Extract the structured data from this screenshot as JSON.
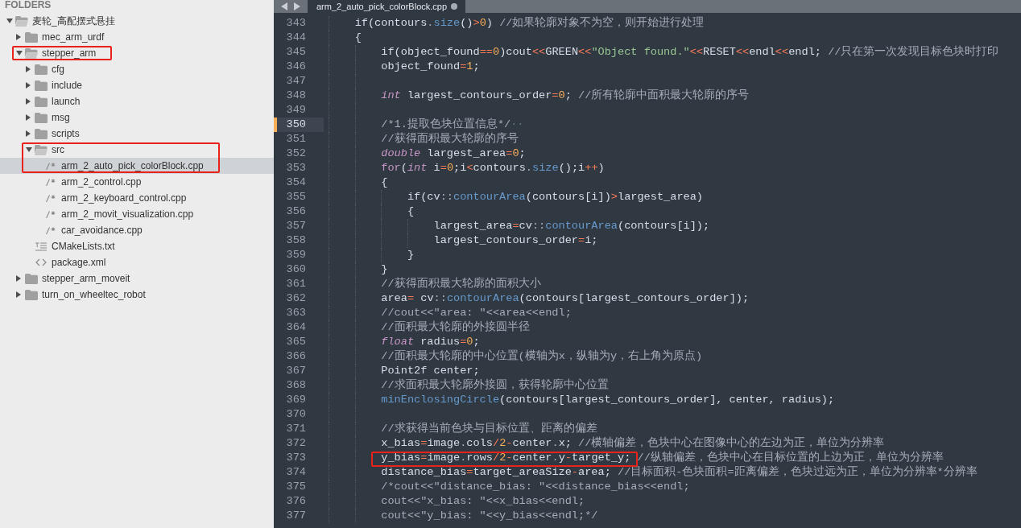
{
  "sidebar": {
    "header": "FOLDERS",
    "tree": [
      {
        "kind": "folder",
        "label": "麦轮_高配摆式悬挂",
        "expanded": true,
        "selected": false,
        "annotated": false,
        "children": [
          {
            "kind": "folder",
            "label": "mec_arm_urdf",
            "expanded": false,
            "selected": false,
            "annotated": false
          },
          {
            "kind": "folder",
            "label": "stepper_arm",
            "expanded": true,
            "selected": false,
            "annotated": true,
            "children": [
              {
                "kind": "folder",
                "label": "cfg",
                "expanded": false,
                "selected": false,
                "annotated": false
              },
              {
                "kind": "folder",
                "label": "include",
                "expanded": false,
                "selected": false,
                "annotated": false
              },
              {
                "kind": "folder",
                "label": "launch",
                "expanded": false,
                "selected": false,
                "annotated": false
              },
              {
                "kind": "folder",
                "label": "msg",
                "expanded": false,
                "selected": false,
                "annotated": false
              },
              {
                "kind": "folder",
                "label": "scripts",
                "expanded": false,
                "selected": false,
                "annotated": false
              },
              {
                "kind": "folder",
                "label": "src",
                "expanded": true,
                "selected": false,
                "annotated": true,
                "children": [
                  {
                    "kind": "source",
                    "label": "arm_2_auto_pick_colorBlock.cpp",
                    "selected": true,
                    "annotated": true
                  },
                  {
                    "kind": "source",
                    "label": "arm_2_control.cpp",
                    "selected": false,
                    "annotated": false
                  },
                  {
                    "kind": "source",
                    "label": "arm_2_keyboard_control.cpp",
                    "selected": false,
                    "annotated": false
                  },
                  {
                    "kind": "source",
                    "label": "arm_2_movit_visualization.cpp",
                    "selected": false,
                    "annotated": false
                  },
                  {
                    "kind": "source",
                    "label": "car_avoidance.cpp",
                    "selected": false,
                    "annotated": false
                  }
                ]
              },
              {
                "kind": "text",
                "label": "CMakeLists.txt",
                "selected": false,
                "annotated": false
              },
              {
                "kind": "markup",
                "label": "package.xml",
                "selected": false,
                "annotated": false
              }
            ]
          },
          {
            "kind": "folder",
            "label": "stepper_arm_moveit",
            "expanded": false,
            "selected": false,
            "annotated": false
          },
          {
            "kind": "folder",
            "label": "turn_on_wheeltec_robot",
            "expanded": false,
            "selected": false,
            "annotated": false
          }
        ]
      }
    ]
  },
  "editor": {
    "tabs": [
      {
        "title": "arm_2_auto_pick_colorBlock.cpp",
        "selected": true,
        "modified": true
      }
    ],
    "lines": [
      {
        "number": "343",
        "current": false,
        "annotated": false,
        "tokens": [
          {
            "kind": "plain",
            "text": "    if(contours"
          },
          {
            "kind": "punct",
            "text": "."
          },
          {
            "kind": "function",
            "text": "size"
          },
          {
            "kind": "plain",
            "text": "()"
          },
          {
            "kind": "operator",
            "text": ">"
          },
          {
            "kind": "number",
            "text": "0"
          },
          {
            "kind": "plain",
            "text": ") "
          },
          {
            "kind": "comment",
            "text": "//如果轮廓对象不为空，则开始进行处理"
          }
        ]
      },
      {
        "number": "344",
        "current": false,
        "annotated": false,
        "tokens": [
          {
            "kind": "plain",
            "text": "    {"
          }
        ]
      },
      {
        "number": "345",
        "current": false,
        "annotated": false,
        "tokens": [
          {
            "kind": "plain",
            "text": "        if(object_found"
          },
          {
            "kind": "operator",
            "text": "=="
          },
          {
            "kind": "number",
            "text": "0"
          },
          {
            "kind": "plain",
            "text": ")cout"
          },
          {
            "kind": "operator",
            "text": "<<"
          },
          {
            "kind": "plain",
            "text": "GREEN"
          },
          {
            "kind": "operator",
            "text": "<<"
          },
          {
            "kind": "string",
            "text": "\"Object found.\""
          },
          {
            "kind": "operator",
            "text": "<<"
          },
          {
            "kind": "plain",
            "text": "RESET"
          },
          {
            "kind": "operator",
            "text": "<<"
          },
          {
            "kind": "plain",
            "text": "endl"
          },
          {
            "kind": "operator",
            "text": "<<"
          },
          {
            "kind": "plain",
            "text": "endl; "
          },
          {
            "kind": "comment",
            "text": "//只在第一次发现目标色块时打印"
          }
        ]
      },
      {
        "number": "346",
        "current": false,
        "annotated": false,
        "tokens": [
          {
            "kind": "plain",
            "text": "        object_found"
          },
          {
            "kind": "operator",
            "text": "="
          },
          {
            "kind": "number",
            "text": "1"
          },
          {
            "kind": "plain",
            "text": ";"
          }
        ]
      },
      {
        "number": "347",
        "current": false,
        "annotated": false
      },
      {
        "number": "348",
        "current": false,
        "annotated": false,
        "tokens": [
          {
            "kind": "type",
            "text": "        int"
          },
          {
            "kind": "plain",
            "text": " largest_contours_order"
          },
          {
            "kind": "operator",
            "text": "="
          },
          {
            "kind": "number",
            "text": "0"
          },
          {
            "kind": "plain",
            "text": "; "
          },
          {
            "kind": "comment",
            "text": "//所有轮廓中面积最大轮廓的序号"
          }
        ]
      },
      {
        "number": "349",
        "current": false,
        "annotated": false
      },
      {
        "number": "350",
        "current": true,
        "annotated": false,
        "tokens": [
          {
            "kind": "comment",
            "text": "        /*1.提取色块位置信息*/"
          },
          {
            "kind": "whitespace",
            "text": "··"
          }
        ]
      },
      {
        "number": "351",
        "current": false,
        "annotated": false,
        "tokens": [
          {
            "kind": "comment",
            "text": "        //获得面积最大轮廓的序号"
          }
        ]
      },
      {
        "number": "352",
        "current": false,
        "annotated": false,
        "tokens": [
          {
            "kind": "type",
            "text": "        double"
          },
          {
            "kind": "plain",
            "text": " largest_area"
          },
          {
            "kind": "operator",
            "text": "="
          },
          {
            "kind": "number",
            "text": "0"
          },
          {
            "kind": "plain",
            "text": ";"
          }
        ]
      },
      {
        "number": "353",
        "current": false,
        "annotated": false,
        "tokens": [
          {
            "kind": "keyword",
            "text": "        for"
          },
          {
            "kind": "plain",
            "text": "("
          },
          {
            "kind": "type",
            "text": "int"
          },
          {
            "kind": "plain",
            "text": " i"
          },
          {
            "kind": "operator",
            "text": "="
          },
          {
            "kind": "number",
            "text": "0"
          },
          {
            "kind": "plain",
            "text": ";i"
          },
          {
            "kind": "operator",
            "text": "<"
          },
          {
            "kind": "plain",
            "text": "contours"
          },
          {
            "kind": "punct",
            "text": "."
          },
          {
            "kind": "function",
            "text": "size"
          },
          {
            "kind": "plain",
            "text": "();i"
          },
          {
            "kind": "operator",
            "text": "++"
          },
          {
            "kind": "plain",
            "text": ")"
          }
        ]
      },
      {
        "number": "354",
        "current": false,
        "annotated": false,
        "tokens": [
          {
            "kind": "plain",
            "text": "        {"
          }
        ]
      },
      {
        "number": "355",
        "current": false,
        "annotated": false,
        "tokens": [
          {
            "kind": "plain",
            "text": "            if(cv"
          },
          {
            "kind": "punct",
            "text": "::"
          },
          {
            "kind": "function",
            "text": "contourArea"
          },
          {
            "kind": "plain",
            "text": "(contours[i])"
          },
          {
            "kind": "operator",
            "text": ">"
          },
          {
            "kind": "plain",
            "text": "largest_area)"
          }
        ]
      },
      {
        "number": "356",
        "current": false,
        "annotated": false,
        "tokens": [
          {
            "kind": "plain",
            "text": "            {"
          }
        ]
      },
      {
        "number": "357",
        "current": false,
        "annotated": false,
        "tokens": [
          {
            "kind": "plain",
            "text": "                largest_area"
          },
          {
            "kind": "operator",
            "text": "="
          },
          {
            "kind": "plain",
            "text": "cv"
          },
          {
            "kind": "punct",
            "text": "::"
          },
          {
            "kind": "function",
            "text": "contourArea"
          },
          {
            "kind": "plain",
            "text": "(contours[i]);"
          }
        ]
      },
      {
        "number": "358",
        "current": false,
        "annotated": false,
        "tokens": [
          {
            "kind": "plain",
            "text": "                largest_contours_order"
          },
          {
            "kind": "operator",
            "text": "="
          },
          {
            "kind": "plain",
            "text": "i;"
          }
        ]
      },
      {
        "number": "359",
        "current": false,
        "annotated": false,
        "tokens": [
          {
            "kind": "plain",
            "text": "            }"
          }
        ]
      },
      {
        "number": "360",
        "current": false,
        "annotated": false,
        "tokens": [
          {
            "kind": "plain",
            "text": "        }"
          }
        ]
      },
      {
        "number": "361",
        "current": false,
        "annotated": false,
        "tokens": [
          {
            "kind": "comment",
            "text": "        //获得面积最大轮廓的面积大小"
          }
        ]
      },
      {
        "number": "362",
        "current": false,
        "annotated": false,
        "tokens": [
          {
            "kind": "plain",
            "text": "        area"
          },
          {
            "kind": "operator",
            "text": "="
          },
          {
            "kind": "plain",
            "text": " cv"
          },
          {
            "kind": "punct",
            "text": "::"
          },
          {
            "kind": "function",
            "text": "contourArea"
          },
          {
            "kind": "plain",
            "text": "(contours[largest_contours_order]);"
          }
        ]
      },
      {
        "number": "363",
        "current": false,
        "annotated": false,
        "tokens": [
          {
            "kind": "comment",
            "text": "        //cout<<\"area: \"<<area<<endl;"
          }
        ]
      },
      {
        "number": "364",
        "current": false,
        "annotated": false,
        "tokens": [
          {
            "kind": "comment",
            "text": "        //面积最大轮廓的外接圆半径"
          }
        ]
      },
      {
        "number": "365",
        "current": false,
        "annotated": false,
        "tokens": [
          {
            "kind": "type",
            "text": "        float"
          },
          {
            "kind": "plain",
            "text": " radius"
          },
          {
            "kind": "operator",
            "text": "="
          },
          {
            "kind": "number",
            "text": "0"
          },
          {
            "kind": "plain",
            "text": ";"
          }
        ]
      },
      {
        "number": "366",
        "current": false,
        "annotated": false,
        "tokens": [
          {
            "kind": "comment",
            "text": "        //面积最大轮廓的中心位置(横轴为x，纵轴为y，右上角为原点)"
          }
        ]
      },
      {
        "number": "367",
        "current": false,
        "annotated": false,
        "tokens": [
          {
            "kind": "plain",
            "text": "        Point2f center;"
          }
        ]
      },
      {
        "number": "368",
        "current": false,
        "annotated": false,
        "tokens": [
          {
            "kind": "comment",
            "text": "        //求面积最大轮廓外接圆，获得轮廓中心位置"
          }
        ]
      },
      {
        "number": "369",
        "current": false,
        "annotated": false,
        "tokens": [
          {
            "kind": "function",
            "text": "        minEnclosingCircle"
          },
          {
            "kind": "plain",
            "text": "(contours[largest_contours_order], center, radius);"
          }
        ]
      },
      {
        "number": "370",
        "current": false,
        "annotated": false
      },
      {
        "number": "371",
        "current": false,
        "annotated": false,
        "tokens": [
          {
            "kind": "comment",
            "text": "        //求获得当前色块与目标位置、距离的偏差"
          }
        ]
      },
      {
        "number": "372",
        "current": false,
        "annotated": false,
        "tokens": [
          {
            "kind": "plain",
            "text": "        x_bias"
          },
          {
            "kind": "operator",
            "text": "="
          },
          {
            "kind": "plain",
            "text": "image"
          },
          {
            "kind": "punct",
            "text": "."
          },
          {
            "kind": "plain",
            "text": "cols"
          },
          {
            "kind": "operator",
            "text": "/"
          },
          {
            "kind": "number",
            "text": "2"
          },
          {
            "kind": "operator",
            "text": "-"
          },
          {
            "kind": "plain",
            "text": "center"
          },
          {
            "kind": "punct",
            "text": "."
          },
          {
            "kind": "plain",
            "text": "x; "
          },
          {
            "kind": "comment",
            "text": "//横轴偏差，色块中心在图像中心的左边为正，单位为分辨率"
          }
        ]
      },
      {
        "number": "373",
        "current": false,
        "annotated": true,
        "tokens": [
          {
            "kind": "plain",
            "text": "        y_bias"
          },
          {
            "kind": "operator",
            "text": "="
          },
          {
            "kind": "plain",
            "text": "image"
          },
          {
            "kind": "punct",
            "text": "."
          },
          {
            "kind": "plain",
            "text": "rows"
          },
          {
            "kind": "operator",
            "text": "/"
          },
          {
            "kind": "number",
            "text": "2"
          },
          {
            "kind": "operator",
            "text": "-"
          },
          {
            "kind": "plain",
            "text": "center"
          },
          {
            "kind": "punct",
            "text": "."
          },
          {
            "kind": "plain",
            "text": "y"
          },
          {
            "kind": "operator",
            "text": "-"
          },
          {
            "kind": "plain",
            "text": "target_y; "
          },
          {
            "kind": "comment",
            "text": "//纵轴偏差，色块中心在目标位置的上边为正，单位为分辨率"
          }
        ]
      },
      {
        "number": "374",
        "current": false,
        "annotated": false,
        "tokens": [
          {
            "kind": "plain",
            "text": "        distance_bias"
          },
          {
            "kind": "operator",
            "text": "="
          },
          {
            "kind": "plain",
            "text": "target_areaSize"
          },
          {
            "kind": "operator",
            "text": "-"
          },
          {
            "kind": "plain",
            "text": "area; "
          },
          {
            "kind": "comment",
            "text": "//目标面积-色块面积=距离偏差，色块过远为正，单位为分辨率*分辨率"
          }
        ]
      },
      {
        "number": "375",
        "current": false,
        "annotated": false,
        "tokens": [
          {
            "kind": "comment",
            "text": "        /*cout<<\"distance_bias: \"<<distance_bias<<endl;"
          }
        ]
      },
      {
        "number": "376",
        "current": false,
        "annotated": false,
        "tokens": [
          {
            "kind": "comment",
            "text": "        cout<<\"x_bias: \"<<x_bias<<endl;"
          }
        ]
      },
      {
        "number": "377",
        "current": false,
        "annotated": false,
        "tokens": [
          {
            "kind": "comment",
            "text": "        cout<<\"y_bias: \"<<y_bias<<endl;*/"
          }
        ]
      }
    ]
  }
}
